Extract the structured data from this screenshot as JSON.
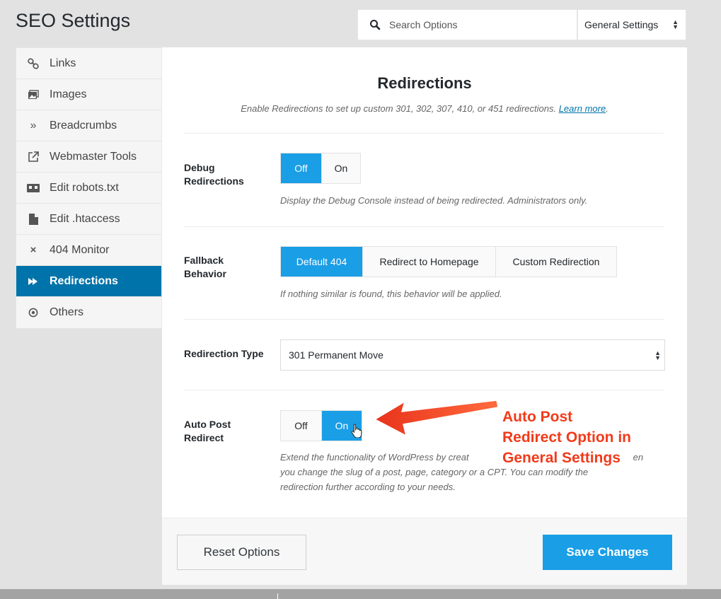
{
  "header": {
    "title": "SEO Settings",
    "search_placeholder": "Search Options",
    "settings_select": "General Settings"
  },
  "sidebar": {
    "items": [
      {
        "label": "Links",
        "icon": "link-icon"
      },
      {
        "label": "Images",
        "icon": "images-icon"
      },
      {
        "label": "Breadcrumbs",
        "icon": "double-chevron-icon"
      },
      {
        "label": "Webmaster Tools",
        "icon": "external-link-icon"
      },
      {
        "label": "Edit robots.txt",
        "icon": "robot-icon"
      },
      {
        "label": "Edit .htaccess",
        "icon": "file-icon"
      },
      {
        "label": "404 Monitor",
        "icon": "close-icon"
      },
      {
        "label": "Redirections",
        "icon": "fast-forward-icon",
        "active": true
      },
      {
        "label": "Others",
        "icon": "circle-dot-icon"
      }
    ]
  },
  "panel": {
    "title": "Redirections",
    "desc": "Enable Redirections to set up custom 301, 302, 307, 410, or 451 redirections.",
    "learn_more": "Learn more",
    "desc_end": ".",
    "debug": {
      "label": "Debug Redirections",
      "off": "Off",
      "on": "On",
      "selected": "Off",
      "help": "Display the Debug Console instead of being redirected. Administrators only."
    },
    "fallback": {
      "label": "Fallback Behavior",
      "options": [
        "Default 404",
        "Redirect to Homepage",
        "Custom Redirection"
      ],
      "selected": "Default 404",
      "help": "If nothing similar is found, this behavior will be applied."
    },
    "type": {
      "label": "Redirection Type",
      "value": "301 Permanent Move"
    },
    "auto": {
      "label": "Auto Post Redirect",
      "off": "Off",
      "on": "On",
      "selected": "On",
      "help1": "Extend the functionality of WordPress by creat",
      "help1_end": "en",
      "help2": "you change the slug of a post, page, category or a CPT. You can modify the",
      "help3": "redirection further according to your needs."
    }
  },
  "footer": {
    "reset": "Reset Options",
    "save": "Save Changes"
  },
  "annotation": {
    "line1": "Auto Post",
    "line2": "Redirect Option in",
    "line3": "General Settings"
  },
  "colors": {
    "accent": "#1a9ee6",
    "sidebar_active": "#0073aa",
    "annotation": "#f23a1a"
  }
}
